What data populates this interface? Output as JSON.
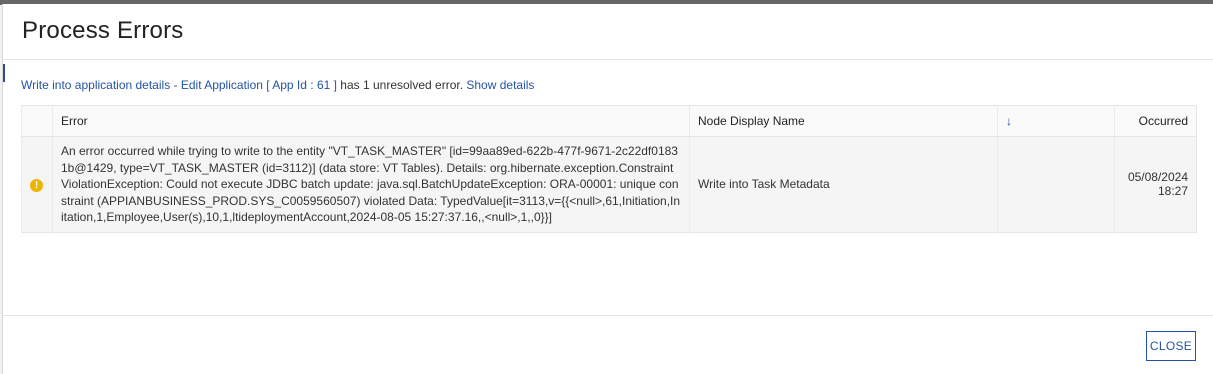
{
  "dialog": {
    "title": "Process Errors"
  },
  "summary": {
    "link1": "Write into application details - Edit Application [ App Id : 61 ]",
    "text": " has 1 unresolved error. ",
    "link2": "Show details"
  },
  "table": {
    "columns": {
      "error": "Error",
      "node": "Node Display Name",
      "sort_icon": "↓",
      "occurred": "Occurred"
    },
    "rows": [
      {
        "status_icon": "warning-icon",
        "error": "An error occurred while trying to write to the entity \"VT_TASK_MASTER\" [id=99aa89ed-622b-477f-9671-2c22df01831b@1429, type=VT_TASK_MASTER (id=3112)] (data store: VT Tables). Details: org.hibernate.exception.ConstraintViolationException: Could not execute JDBC batch update: java.sql.BatchUpdateException: ORA-00001: unique constraint (APPIANBUSINESS_PROD.SYS_C0059560507) violated Data: TypedValue[it=3113,v={{<null>,61,Initiation,Initation,1,Employee,User(s),10,1,ltideploymentAccount,2024-08-05 15:27:37.16,,<null>,1,,0}}]",
        "node": "Write into Task Metadata",
        "occurred": "05/08/2024 18:27"
      }
    ]
  },
  "footer": {
    "close_label": "CLOSE"
  },
  "colors": {
    "link": "#2354a3",
    "warning": "#f0b400"
  }
}
